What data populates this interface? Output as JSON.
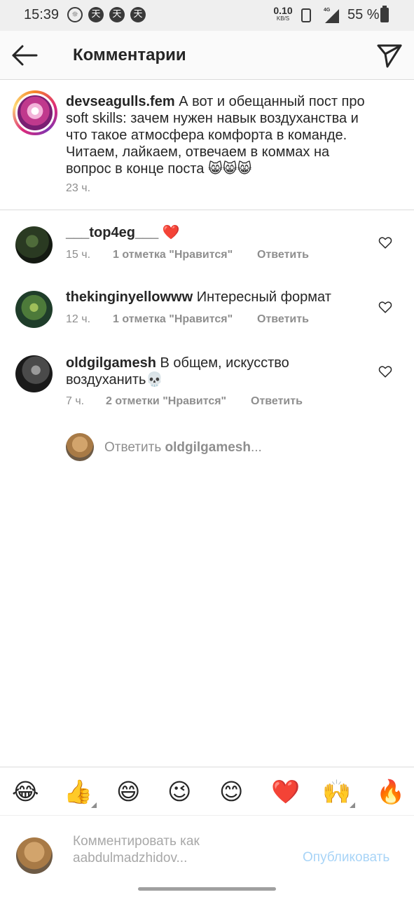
{
  "status_bar": {
    "time": "15:39",
    "net_speed_value": "0.10",
    "net_speed_unit": "KB/S",
    "network_type": "4G",
    "battery_percent": "55 %"
  },
  "header": {
    "title": "Комментарии"
  },
  "post": {
    "username": "devseagulls.fem",
    "text": "А вот и обещанный пост про soft skills: зачем нужен навык воздуханства и что такое атмосфера комфорта в команде. Читаем, лайкаем, отвечаем в коммах на вопрос в конце поста 😸😸😸",
    "time": "23 ч."
  },
  "comments": [
    {
      "username": "___top4eg___",
      "text": "❤️",
      "time": "15 ч.",
      "likes": "1 отметка \"Нравится\"",
      "reply": "Ответить"
    },
    {
      "username": "thekinginyellowww",
      "text": "Интересный формат",
      "time": "12 ч.",
      "likes": "1 отметка \"Нравится\"",
      "reply": "Ответить"
    },
    {
      "username": "oldgilgamesh",
      "text": "В общем, искусство воздуханить💀",
      "time": "7 ч.",
      "likes": "2 отметки \"Нравится\"",
      "reply": "Ответить"
    }
  ],
  "reply_prompt": {
    "prefix": "Ответить ",
    "username": "oldgilgamesh",
    "suffix": "..."
  },
  "emoji_bar": [
    "😂",
    "👍",
    "😄",
    "😉",
    "😊",
    "❤️",
    "🙌",
    "🔥"
  ],
  "composer": {
    "placeholder": "Комментировать как aabdulmadzhidov...",
    "post_label": "Опубликовать"
  },
  "colors": {
    "secondary_text": "#8e8e8e",
    "post_button_disabled": "#a8d4f7",
    "heart_red": "#e0242a"
  }
}
